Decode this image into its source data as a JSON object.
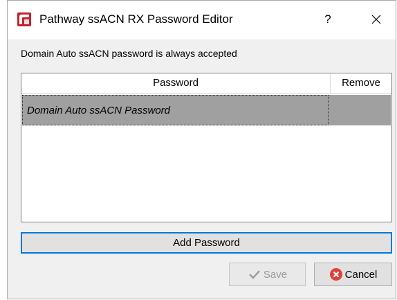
{
  "window": {
    "title": "Pathway ssACN RX Password Editor",
    "help_label": "?",
    "logo_icon": "pathway-logo-icon",
    "close_icon": "close-icon"
  },
  "info_text": "Domain Auto ssACN password is always accepted",
  "table": {
    "columns": [
      "Password",
      "Remove"
    ],
    "rows": [
      {
        "password": "Domain Auto ssACN Password",
        "remove": ""
      }
    ]
  },
  "buttons": {
    "add_password": "Add Password",
    "save": "Save",
    "save_icon": "checkmark-icon",
    "save_enabled": false,
    "cancel": "Cancel",
    "cancel_icon": "cancel-x-icon"
  },
  "colors": {
    "accent": "#0078d7",
    "logo_red": "#c7202e",
    "row_selected": "#a0a0a0",
    "cancel_red": "#e2403a"
  }
}
